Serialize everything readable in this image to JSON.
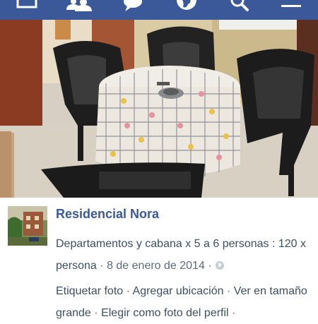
{
  "nav": {
    "icons": [
      "home-icon",
      "friends-icon",
      "messages-icon",
      "globe-icon",
      "search-icon",
      "menu-icon"
    ],
    "bar_color": "#3b5998"
  },
  "post": {
    "author": "Residencial Nora",
    "description": "Departamentos y cabana x 5 a 6 personas : 120 x persona",
    "date": "8 de enero de 2014",
    "separator": "·",
    "privacy_icon": "globe-icon",
    "actions": [
      "Etiquetar foto",
      "Agregar ubicación",
      "Ver en tamaño grande",
      "Elegir como foto del perfil"
    ]
  },
  "colors": {
    "accent": "#3b5998",
    "text": "#3d4f63"
  }
}
